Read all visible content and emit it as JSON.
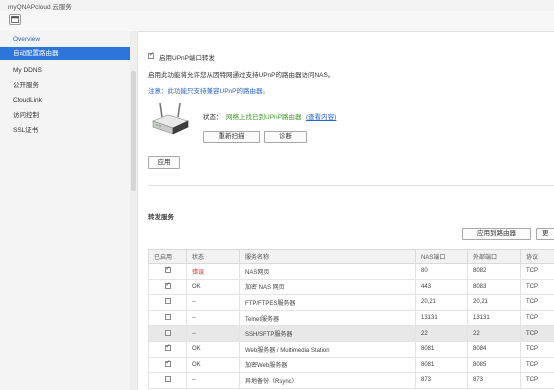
{
  "window": {
    "title": "myQNAPcloud 云服务"
  },
  "sidebar": {
    "items": [
      {
        "label": "Overview"
      },
      {
        "label": "自动配置路由器"
      },
      {
        "label": "My DDNS"
      },
      {
        "label": "公开服务"
      },
      {
        "label": "CloudLink"
      },
      {
        "label": "访问控制"
      },
      {
        "label": "SSL证书"
      }
    ]
  },
  "upnp": {
    "enable_label": "启用UPnP端口转发",
    "enabled": true,
    "description": "启用此功能将允许您从因特网通过支持UPnP的路由器访问NAS。",
    "note": "注意：此功能只支持兼容UPnP的路由器。",
    "status_label": "状态：",
    "status_text": "网络上找已到UPnP路由器",
    "details_link": "(查看内容)",
    "rescan_button": "重新扫描",
    "diagnose_button": "诊断",
    "apply_button": "应用"
  },
  "forwarding": {
    "title": "转发服务",
    "apply_to_router_button": "应用到路由器",
    "truncated_button": "更",
    "columns": [
      "已启用",
      "状态",
      "服务名称",
      "NAS端口",
      "外部端口",
      "协议"
    ],
    "rows": [
      {
        "enabled": true,
        "status": "错误",
        "status_color": "#d12b2b",
        "service": "NAS网页",
        "nas_port": "80",
        "ext_port": "8082",
        "protocol": "TCP"
      },
      {
        "enabled": true,
        "status": "OK",
        "status_color": "#444444",
        "service": "加密 NAS 网页",
        "nas_port": "443",
        "ext_port": "8083",
        "protocol": "TCP"
      },
      {
        "enabled": false,
        "status": "--",
        "status_color": "#444444",
        "service": "FTP/FTPES服务器",
        "nas_port": "20,21",
        "ext_port": "20,21",
        "protocol": "TCP"
      },
      {
        "enabled": false,
        "status": "--",
        "status_color": "#444444",
        "service": "Telnet服务器",
        "nas_port": "13131",
        "ext_port": "13131",
        "protocol": "TCP"
      },
      {
        "enabled": false,
        "status": "--",
        "status_color": "#444444",
        "service": "SSH/SFTP服务器",
        "nas_port": "22",
        "ext_port": "22",
        "protocol": "TCP",
        "selected": true
      },
      {
        "enabled": true,
        "status": "OK",
        "status_color": "#444444",
        "service": "Web服务器 / Multimedia Station",
        "nas_port": "8081",
        "ext_port": "8084",
        "protocol": "TCP"
      },
      {
        "enabled": true,
        "status": "OK",
        "status_color": "#444444",
        "service": "加密Web服务器",
        "nas_port": "8081",
        "ext_port": "8085",
        "protocol": "TCP"
      },
      {
        "enabled": false,
        "status": "--",
        "status_color": "#444444",
        "service": "异地备份（Rsync）",
        "nas_port": "873",
        "ext_port": "873",
        "protocol": "TCP"
      }
    ]
  }
}
